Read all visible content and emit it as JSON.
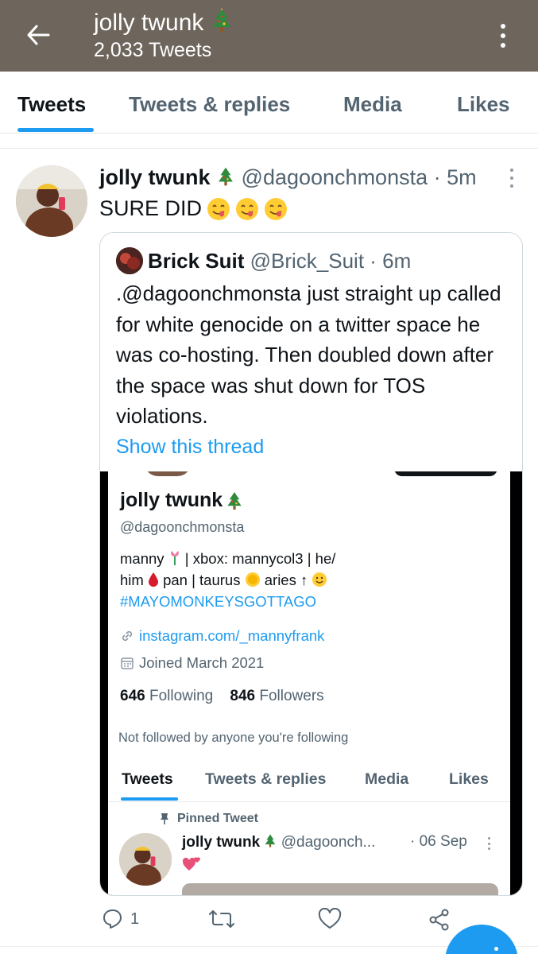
{
  "header": {
    "title": "jolly twunk",
    "tweet_count": "2,033 Tweets",
    "back_icon": "arrow-left-icon",
    "more_icon": "more-vertical-icon",
    "background": "#6e655c"
  },
  "tabs": [
    {
      "label": "Tweets",
      "active": true
    },
    {
      "label": "Tweets & replies",
      "active": false
    },
    {
      "label": "Media",
      "active": false
    },
    {
      "label": "Likes",
      "active": false
    }
  ],
  "tweet": {
    "name": "jolly twunk",
    "handle": "@dagoonchmonsta",
    "time": "· 5m",
    "text": "SURE DID",
    "emoji_icon": "yum-face-emoji-icon",
    "quoted": {
      "name": "Brick Suit",
      "handle": "@Brick_Suit",
      "time": "· 6m",
      "text": ".@dagoonchmonsta just straight up called for white genocide on a twitter space he was co-hosting. Then doubled down after the space was shut down for TOS violations.",
      "show_thread": "Show this thread",
      "screenshot": {
        "name": "jolly twunk",
        "handle": "@dagoonchmonsta",
        "bio_line1": "manny",
        "bio_line1_rest": " | xbox: mannycol3 | he/",
        "bio_line2_a": "him",
        "bio_line2_b": "pan | taurus",
        "bio_line2_c": "aries ↑",
        "hashtag": "#MAYOMONKEYSGOTTAGO",
        "link": "instagram.com/_mannyfrank",
        "joined": "Joined March 2021",
        "following_count": "646",
        "following_label": "Following",
        "followers_count": "846",
        "followers_label": "Followers",
        "not_followed": "Not followed by anyone you're following",
        "tabs": [
          "Tweets",
          "Tweets & replies",
          "Media",
          "Likes"
        ],
        "pinned_label": "Pinned Tweet",
        "pinned_name": "jolly twunk",
        "pinned_handle": "@dagoonch...",
        "pinned_date": "· 06 Sep"
      }
    },
    "actions": {
      "reply_count": "1",
      "retweet_count": "",
      "like_count": ""
    }
  },
  "colors": {
    "accent": "#1d9bf0",
    "text_secondary": "#536471"
  }
}
